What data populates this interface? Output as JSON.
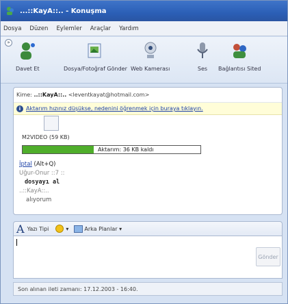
{
  "window": {
    "title": "...::KayA::.. - Konuşma"
  },
  "menu": [
    "Dosya",
    "Düzen",
    "Eylemler",
    "Araçlar",
    "Yardım"
  ],
  "toolbar": {
    "small_button_label": "»",
    "items": [
      {
        "label": "Davet Et",
        "icon": "invite-contact-icon"
      },
      {
        "label": "Dosya/Fotoğraf Gönder",
        "icon": "send-files-icon"
      },
      {
        "label": "Web Kamerası",
        "icon": "webcam-icon"
      },
      {
        "label": "Ses",
        "icon": "audio-icon"
      },
      {
        "label": "Bağlantısı Sited",
        "icon": "activities-icon"
      }
    ]
  },
  "conversation": {
    "to_prefix": "Kime:",
    "to_name": "..::KayA::..",
    "to_email": "<leventkayat@hotmail.com>",
    "info_text": "Aktarım hızınız düşükse, nedenini öğrenmek için buraya tıklayın.",
    "file_name": "M2VIDEO (59 KB)",
    "progress_fraction": 0.4,
    "progress_text": "Aktarım: 36 KB kaldı",
    "cancel_text": "İptal",
    "cancel_shortcut": "(Alt+Q)",
    "sender_line": "Uğur-Onur ::7 ::",
    "message_1": "dosyayı al",
    "sender_line_2": "..::KayA::..",
    "message_2": "alıyorum"
  },
  "format": {
    "font_label": "Yazı Tipi",
    "emoticon_label": "▾",
    "background_label": "Arka Planlar ▾"
  },
  "compose": {
    "send_label": "Gönder"
  },
  "status": {
    "text": "Son alınan ileti zamanı: 17.12.2003 - 16:40."
  },
  "colors": {
    "title_bar": "#2b5fb6",
    "progress": "#4fae2b",
    "info_bar": "#fffdd8"
  }
}
